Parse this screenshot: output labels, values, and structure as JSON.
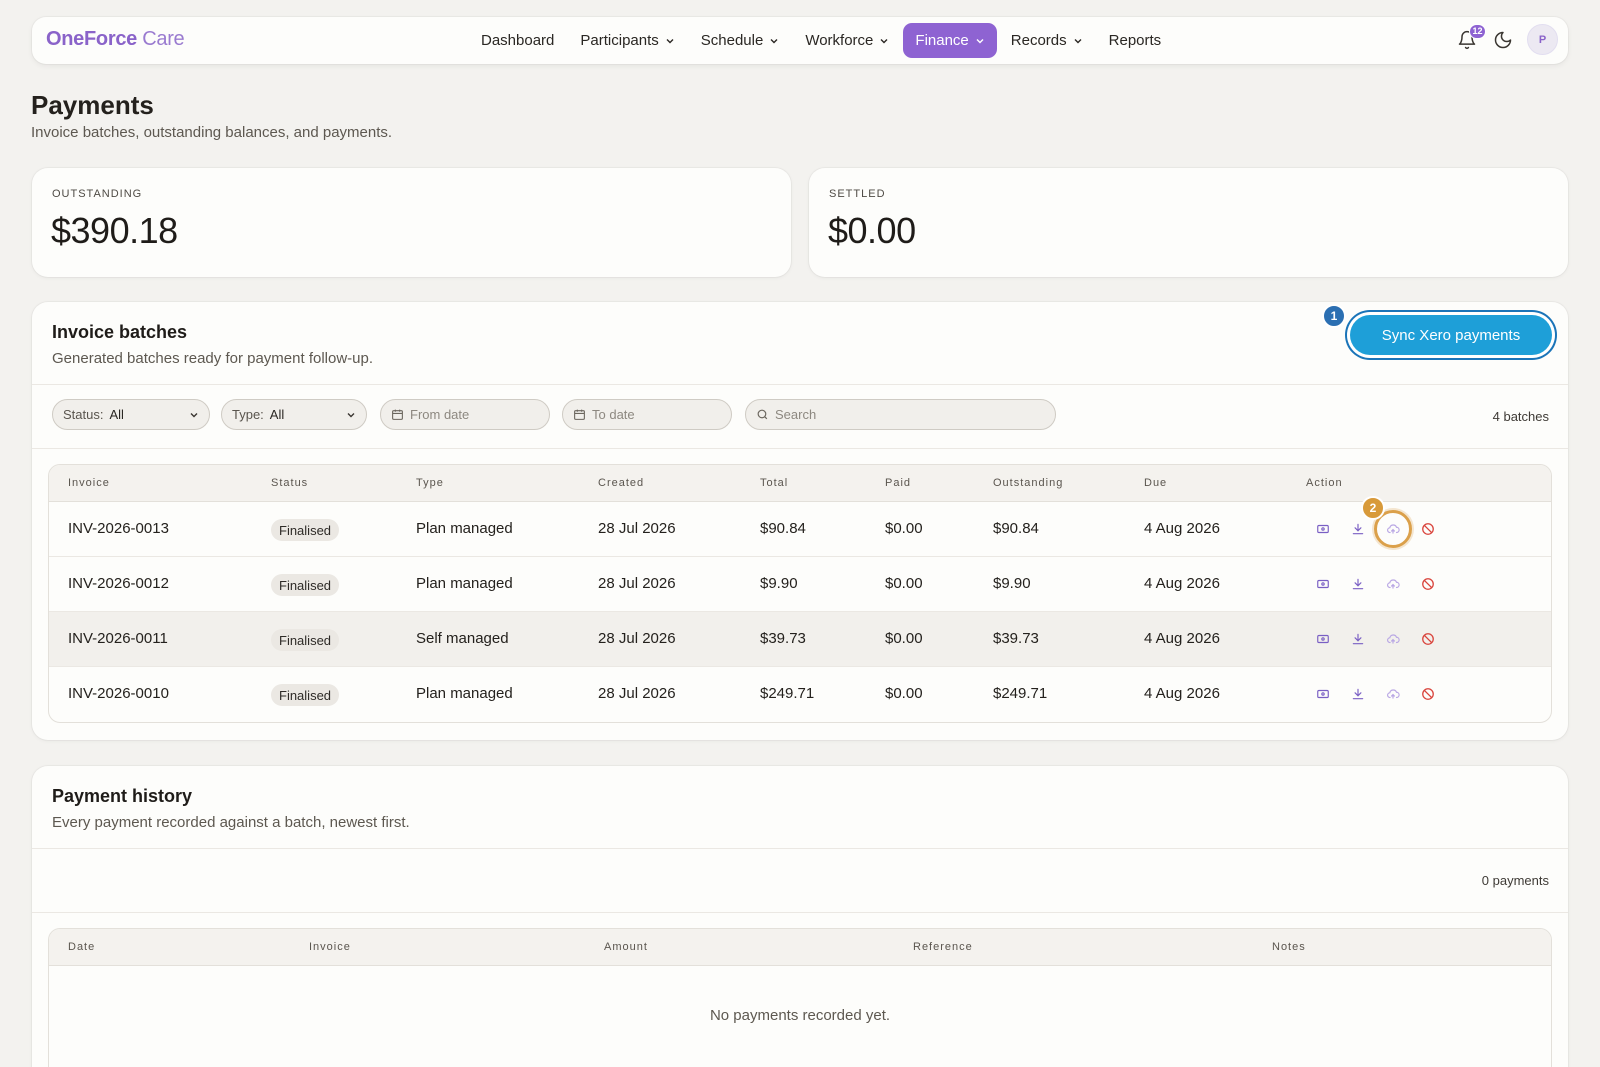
{
  "app": {
    "brand_primary": "OneForce",
    "brand_secondary": "Care",
    "accent_color": "#8e63d2"
  },
  "nav": {
    "items": [
      {
        "label": "Dashboard",
        "has_menu": false
      },
      {
        "label": "Participants",
        "has_menu": true
      },
      {
        "label": "Schedule",
        "has_menu": true
      },
      {
        "label": "Workforce",
        "has_menu": true
      },
      {
        "label": "Finance",
        "has_menu": true,
        "active": true
      },
      {
        "label": "Records",
        "has_menu": true
      },
      {
        "label": "Reports",
        "has_menu": false
      }
    ],
    "notification_count": "12",
    "avatar_initial": "P"
  },
  "page": {
    "title": "Payments",
    "subtitle": "Invoice batches, outstanding balances, and payments."
  },
  "stats": {
    "outstanding_label": "OUTSTANDING",
    "outstanding_value": "$390.18",
    "settled_label": "SETTLED",
    "settled_value": "$0.00"
  },
  "batches": {
    "title": "Invoice batches",
    "subtitle": "Generated batches ready for payment follow-up.",
    "sync_button": "Sync Xero payments",
    "sync_step": "1",
    "action_step": "2",
    "filters": {
      "status_label": "Status:",
      "status_value": "All",
      "type_label": "Type:",
      "type_value": "All",
      "from_placeholder": "From date",
      "to_placeholder": "To date",
      "search_placeholder": "Search"
    },
    "count": "4 batches",
    "columns": [
      "Invoice",
      "Status",
      "Type",
      "Created",
      "Total",
      "Paid",
      "Outstanding",
      "Due",
      "Action"
    ],
    "rows": [
      {
        "invoice": "INV-2026-0013",
        "status": "Finalised",
        "type": "Plan managed",
        "created": "28 Jul 2026",
        "total": "$90.84",
        "paid": "$0.00",
        "outstanding": "$90.84",
        "due": "4 Aug 2026"
      },
      {
        "invoice": "INV-2026-0012",
        "status": "Finalised",
        "type": "Plan managed",
        "created": "28 Jul 2026",
        "total": "$9.90",
        "paid": "$0.00",
        "outstanding": "$9.90",
        "due": "4 Aug 2026"
      },
      {
        "invoice": "INV-2026-0011",
        "status": "Finalised",
        "type": "Self managed",
        "created": "28 Jul 2026",
        "total": "$39.73",
        "paid": "$0.00",
        "outstanding": "$39.73",
        "due": "4 Aug 2026"
      },
      {
        "invoice": "INV-2026-0010",
        "status": "Finalised",
        "type": "Plan managed",
        "created": "28 Jul 2026",
        "total": "$249.71",
        "paid": "$0.00",
        "outstanding": "$249.71",
        "due": "4 Aug 2026"
      }
    ]
  },
  "history": {
    "title": "Payment history",
    "subtitle": "Every payment recorded against a batch, newest first.",
    "count": "0 payments",
    "columns": [
      "Date",
      "Invoice",
      "Amount",
      "Reference",
      "Notes"
    ],
    "empty_message": "No payments recorded yet."
  }
}
